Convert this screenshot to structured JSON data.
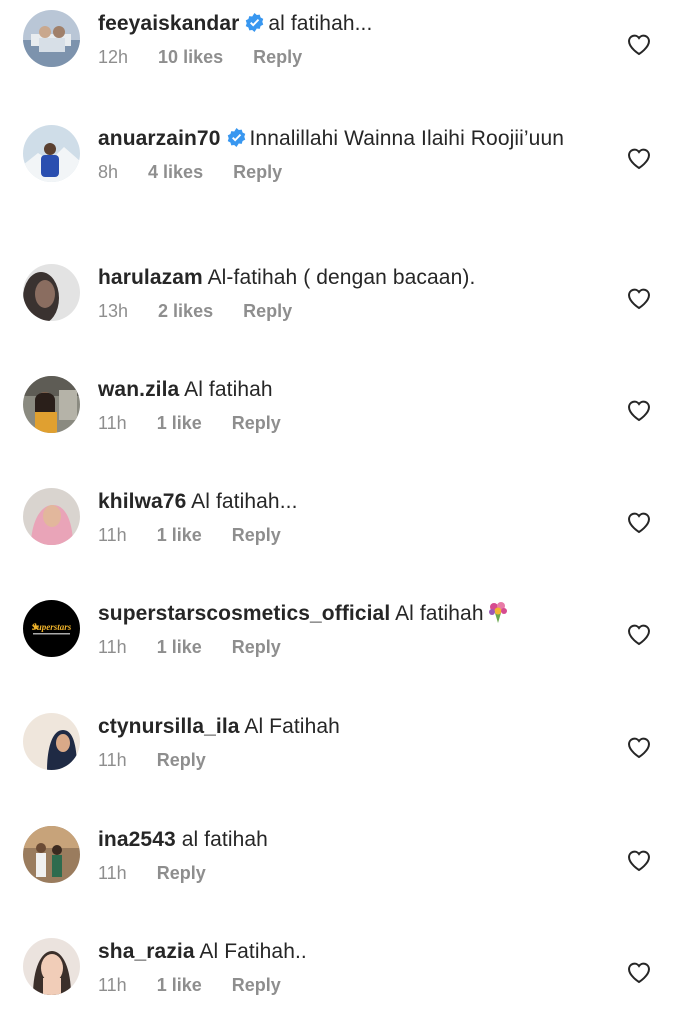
{
  "comments": [
    {
      "username": "feeyaiskandar",
      "verified": true,
      "text": "al fatihah...",
      "time": "12h",
      "likes": "10 likes",
      "reply": "Reply",
      "avatar": "avatar-boat"
    },
    {
      "username": "anuarzain70",
      "verified": true,
      "text": "Innalillahi Wainna Ilaihi Roojii’uun",
      "time": "8h",
      "likes": "4 likes",
      "reply": "Reply",
      "avatar": "avatar-snow"
    },
    {
      "username": "harulazam",
      "verified": false,
      "text": "Al-fatihah ( dengan bacaan).",
      "time": "13h",
      "likes": "2 likes",
      "reply": "Reply",
      "avatar": "avatar-face-dark"
    },
    {
      "username": "wan.zila",
      "verified": false,
      "text": "Al fatihah",
      "time": "11h",
      "likes": "1 like",
      "reply": "Reply",
      "avatar": "avatar-woman-library"
    },
    {
      "username": "khilwa76",
      "verified": false,
      "text": "Al fatihah...",
      "time": "11h",
      "likes": "1 like",
      "reply": "Reply",
      "avatar": "avatar-woman-pink-hijab"
    },
    {
      "username": "superstarscosmetics_official",
      "verified": false,
      "text": "Al fatihah",
      "time": "11h",
      "likes": "1 like",
      "reply": "Reply",
      "avatar": "avatar-superstars-logo",
      "emoji": "bouquet-emoji",
      "logo_text": "Superstars"
    },
    {
      "username": "ctynursilla_ila",
      "verified": false,
      "text": "Al Fatihah",
      "time": "11h",
      "likes": "",
      "reply": "Reply",
      "avatar": "avatar-woman-dark-hijab"
    },
    {
      "username": "ina2543",
      "verified": false,
      "text": "al fatihah",
      "time": "11h",
      "likes": "",
      "reply": "Reply",
      "avatar": "avatar-group-photo"
    },
    {
      "username": "sha_razia",
      "verified": false,
      "text": "Al Fatihah..",
      "time": "11h",
      "likes": "1 like",
      "reply": "Reply",
      "avatar": "avatar-woman-light"
    }
  ],
  "colors": {
    "text": "#262626",
    "meta": "#8e8e8e",
    "verified": "#3897f0",
    "heart": "#262626"
  },
  "icons": {
    "like": "heart-outline-icon",
    "verified": "verified-badge-icon"
  }
}
